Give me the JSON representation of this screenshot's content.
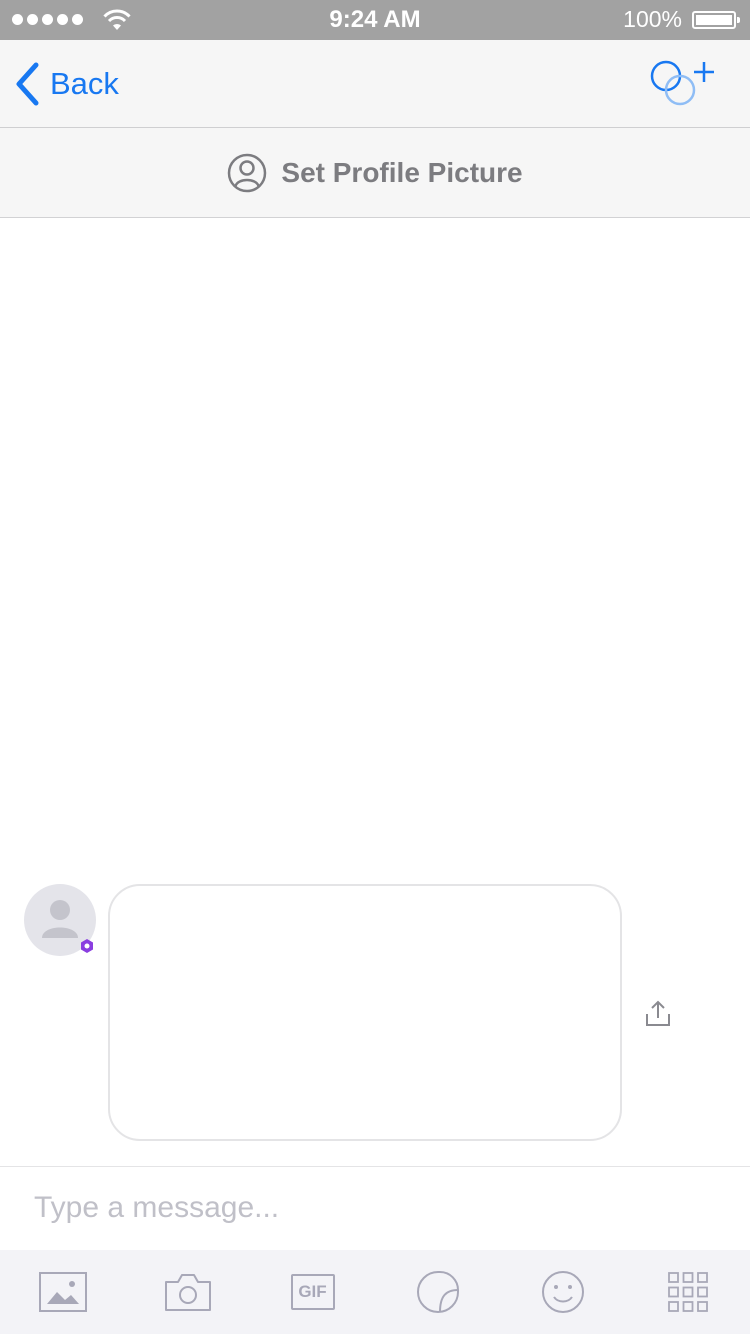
{
  "status_bar": {
    "time": "9:24 AM",
    "battery_percent": "100%",
    "signal_bars": 5,
    "icons": [
      "signal-dots-icon",
      "wifi-icon",
      "battery-icon"
    ]
  },
  "nav": {
    "back_label": "Back",
    "icons": [
      "chevron-left-icon",
      "add-participants-icon"
    ],
    "accent_color": "#1878f1"
  },
  "profile_prompt": {
    "label": "Set Profile Picture",
    "icon": "user-circle-icon"
  },
  "conversation": {
    "avatar_icon": "default-avatar-icon",
    "badge_icon": "purple-hexagon-badge-icon",
    "share_icon": "share-icon",
    "badge_color": "#8a3ee0"
  },
  "composer": {
    "placeholder": "Type a message..."
  },
  "toolbar": {
    "items": [
      "photo-library-icon",
      "camera-icon",
      "gif-icon",
      "sticker-icon",
      "emoji-icon",
      "apps-grid-icon"
    ],
    "gif_label": "GIF",
    "icon_color": "#a8a8b8"
  }
}
